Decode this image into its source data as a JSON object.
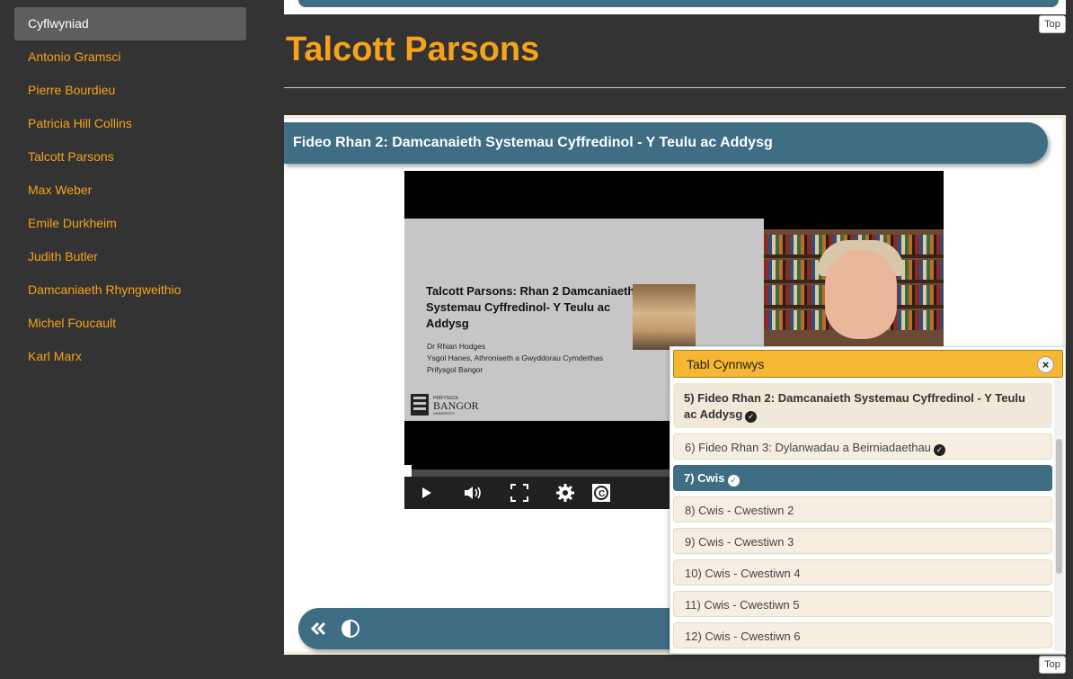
{
  "sidebar": {
    "items": [
      {
        "label": "Cyflwyniad"
      },
      {
        "label": "Antonio Gramsci"
      },
      {
        "label": "Pierre Bourdieu"
      },
      {
        "label": "Patricia Hill Collins"
      },
      {
        "label": "Talcott Parsons"
      },
      {
        "label": "Max Weber"
      },
      {
        "label": "Emile Durkheim"
      },
      {
        "label": "Judith Butler"
      },
      {
        "label": "Damcaniaeth Rhyngweithio"
      },
      {
        "label": "Michel Foucault"
      },
      {
        "label": "Karl Marx"
      }
    ],
    "active_index": 0
  },
  "top_button_label": "Top",
  "page_title": "Talcott Parsons",
  "section_banner": "Fideo Rhan 2: Damcanaieth Systemau Cyffredinol  - Y Teulu ac Addysg",
  "video": {
    "slide_title": "Talcott Parsons: Rhan 2 Damcaniaeth Systemau Cyffredinol- Y Teulu ac Addysg",
    "slide_author": "Dr Rhian Hodges",
    "slide_school": "Ysgol Hanes, Athroniaeth a Gwyddorau Cymdeithas",
    "slide_university": "Prifysgol Bangor",
    "logo_text": "BANGOR",
    "logo_small_top": "PRIFYSGOL",
    "logo_small_bottom": "UNIVERSITY",
    "progress": 0.0
  },
  "icons": {
    "play": "play-icon",
    "volume": "volume-icon",
    "fullscreen": "fullscreen-icon",
    "settings": "gear-icon",
    "captions": "captions-icon",
    "prev": "double-chevron-left-icon",
    "contrast": "contrast-icon"
  },
  "toc": {
    "title": "Tabl Cynnwys",
    "items": [
      {
        "label": "5) Fideo Rhan 2: Damcanaieth Systemau Cyffredinol  - Y Teulu ac Addysg",
        "completed": true
      },
      {
        "label": "6) Fideo Rhan 3: Dylanwadau a Beirniadaethau",
        "completed": true
      },
      {
        "label": "7) Cwis",
        "completed": true
      },
      {
        "label": "8) Cwis - Cwestiwn 2",
        "completed": false
      },
      {
        "label": "9) Cwis - Cwestiwn 3",
        "completed": false
      },
      {
        "label": "10) Cwis - Cwestiwn 4",
        "completed": false
      },
      {
        "label": "11) Cwis - Cwestiwn 5",
        "completed": false
      },
      {
        "label": "12) Cwis - Cwestiwn 6",
        "completed": false
      }
    ]
  },
  "colors": {
    "accent_orange": "#f7a21b",
    "banner_blue": "#3f6d84",
    "toc_header": "#f7b733",
    "background": "#333333"
  }
}
